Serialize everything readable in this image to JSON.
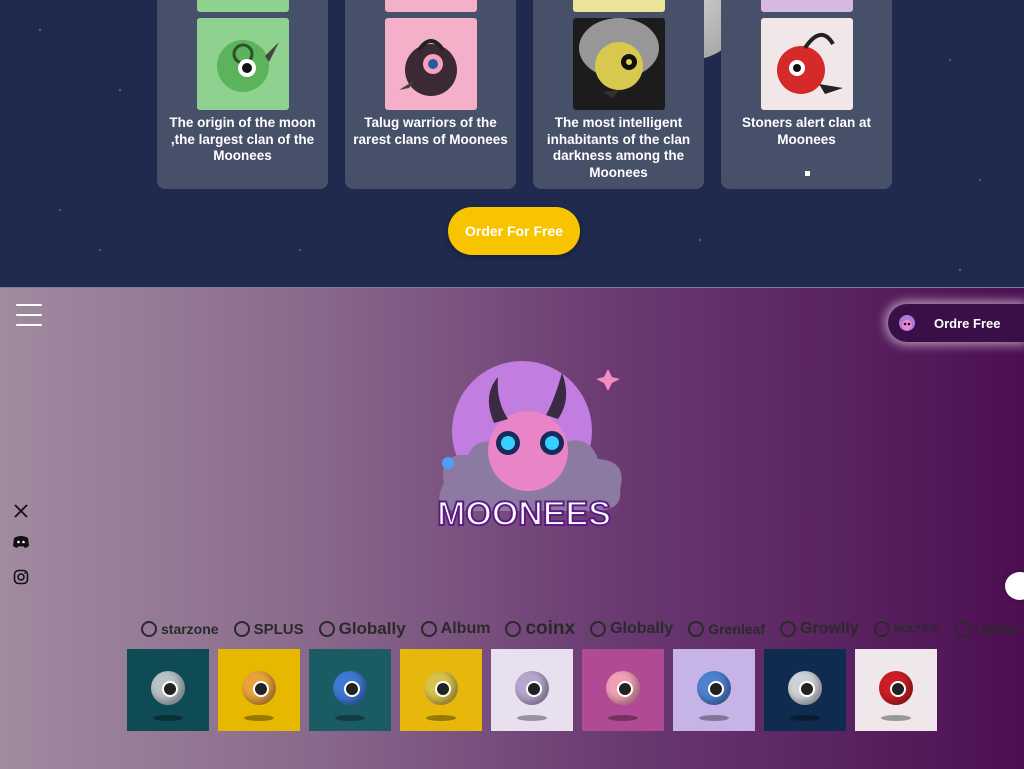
{
  "clans": [
    {
      "caption": "The origin of the moon ,the largest clan of the Moonees",
      "bg": "#8fd18f",
      "ball": "#5bb35b"
    },
    {
      "caption": "Talug warriors of the rarest clans of Moonees",
      "bg": "#f3b0c8",
      "ball": "#3b2a33"
    },
    {
      "caption": "The most intelligent inhabitants of the clan darkness among the Moonees",
      "bg": "#1c1c1c",
      "ball": "#d8c94e"
    },
    {
      "caption": "Stoners alert clan at Moonees",
      "bg": "#f2e7e8",
      "ball": "#d62a2a"
    }
  ],
  "order_button": "Order For Free",
  "nav": {
    "ordre_button": "Ordre Free"
  },
  "logo_text": "MOONEES",
  "social": [
    "x-icon",
    "discord-icon",
    "instagram-icon"
  ],
  "brands": [
    "starzone",
    "SPLUS",
    "Globally",
    "Album",
    "coinx",
    "Globally",
    "Grenleaf",
    "Growlly",
    "MOLTIFIS",
    "Lightsp"
  ],
  "gallery": [
    {
      "bg": "#0e4b55",
      "ball": "#b9c2c7"
    },
    {
      "bg": "#e8b800",
      "ball": "#e8a33d"
    },
    {
      "bg": "#1b5c64",
      "ball": "#3f79d6"
    },
    {
      "bg": "#e7b70b",
      "ball": "#d9c24a"
    },
    {
      "bg": "#e8e0ef",
      "ball": "#b7a7cf"
    },
    {
      "bg": "#b14a94",
      "ball": "#f29fb6"
    },
    {
      "bg": "#c6b3e8",
      "ball": "#4f82d1"
    },
    {
      "bg": "#0f2b4f",
      "ball": "#cfd2d6"
    },
    {
      "bg": "#efe7ea",
      "ball": "#cc1f25"
    }
  ]
}
